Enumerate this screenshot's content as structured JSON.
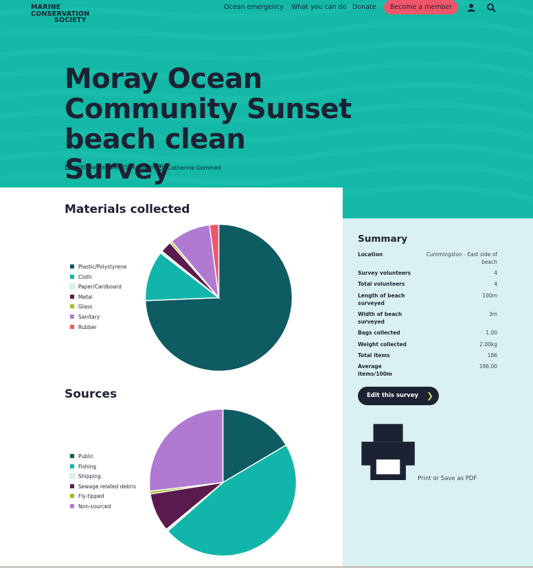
{
  "brand": {
    "logo_line1": "MARINE",
    "logo_line2": "CONSERVATION",
    "logo_line3": "SOCIETY"
  },
  "nav": {
    "items": [
      "Ocean emergency",
      "What you can do",
      "Donate"
    ],
    "cta": "Become a member",
    "account_icon": "user-icon",
    "search_icon": "search-icon"
  },
  "page": {
    "title": "Moray Ocean Community Sunset beach clean Survey",
    "date": "20th September 2024 - 6p.m.",
    "author": "Catherine Gemmell"
  },
  "materials": {
    "heading": "Materials collected",
    "legend": [
      {
        "label": "Plastic/Polystyrene",
        "color": "#0e5b62",
        "value": 74
      },
      {
        "label": "Cloth",
        "color": "#12b5aa",
        "value": 11
      },
      {
        "label": "Paper/Cardboard",
        "color": "#dff2f2",
        "value": 0.5
      },
      {
        "label": "Metal",
        "color": "#5b1a4d",
        "value": 2.5
      },
      {
        "label": "Glass",
        "color": "#9bc01c",
        "value": 0.5
      },
      {
        "label": "Sanitary",
        "color": "#b07ad2",
        "value": 9
      },
      {
        "label": "Rubber",
        "color": "#f0566a",
        "value": 2
      }
    ]
  },
  "sources": {
    "heading": "Sources",
    "legend": [
      {
        "label": "Public",
        "color": "#0e5b62",
        "value": 16.5
      },
      {
        "label": "Fishing",
        "color": "#12b5aa",
        "value": 47
      },
      {
        "label": "Shipping",
        "color": "#dff2f2",
        "value": 0.5
      },
      {
        "label": "Sewage related debris",
        "color": "#5b1a4d",
        "value": 8.5
      },
      {
        "label": "Fly-tipped",
        "color": "#9bc01c",
        "value": 0.6
      },
      {
        "label": "Non-sourced",
        "color": "#b07ad2",
        "value": 26.9
      }
    ]
  },
  "summary": {
    "heading": "Summary",
    "rows": [
      {
        "key": "Location",
        "value": "Cummingston - East side of beach"
      },
      {
        "key": "Survey volunteers",
        "value": "4"
      },
      {
        "key": "Total volunteers",
        "value": "4"
      },
      {
        "key": "Length of beach surveyed",
        "value": "100m"
      },
      {
        "key": "Width of beach surveyed",
        "value": "3m"
      },
      {
        "key": "Bags collected",
        "value": "1.00"
      },
      {
        "key": "Weight collected",
        "value": "2.00kg"
      },
      {
        "key": "Total items",
        "value": "186"
      },
      {
        "key": "Average items/100m",
        "value": "186.00"
      }
    ],
    "edit_label": "Edit this survey",
    "print_label": "Print or Save as PDF"
  }
}
